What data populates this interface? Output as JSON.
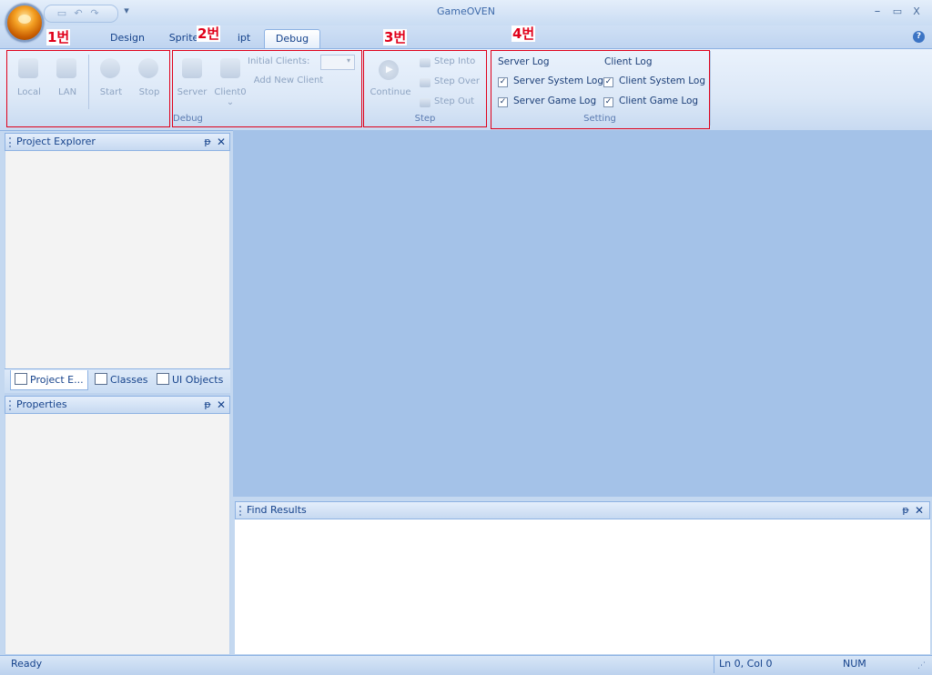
{
  "app": {
    "title": "GameOVEN"
  },
  "titlebar": {
    "minimize": "–",
    "maximize": "▭",
    "close": "X"
  },
  "qat": {
    "save_icon": "save-icon",
    "undo_icon": "undo-icon",
    "redo_icon": "redo-icon",
    "customize": "▾"
  },
  "tabs": [
    {
      "label": "Design"
    },
    {
      "label": "Sprite"
    },
    {
      "label": "ipt"
    },
    {
      "label": "Debug",
      "active": true
    }
  ],
  "help": "?",
  "ribbon": {
    "debug_group": {
      "label": "Debug",
      "buttons": {
        "local": "Local",
        "lan": "LAN",
        "start": "Start",
        "stop": "Stop",
        "server": "Server",
        "client0": "Client0"
      },
      "initial_clients_label": "Initial Clients:",
      "initial_clients_value": "",
      "add_client": "Add New Client"
    },
    "step_group": {
      "label": "Step",
      "continue": "Continue",
      "step_into": "Step Into",
      "step_over": "Step Over",
      "step_out": "Step Out"
    },
    "setting_group": {
      "label": "Setting",
      "server_log": "Server Log",
      "client_log": "Client Log",
      "server_system_log": "Server System Log",
      "client_system_log": "Client System Log",
      "server_game_log": "Server Game Log",
      "client_game_log": "Client Game Log",
      "check": "✓"
    }
  },
  "annotations": {
    "a1": "1번",
    "a2": "2번",
    "a3": "3번",
    "a4": "4번"
  },
  "panes": {
    "project_explorer": {
      "title": "Project Explorer"
    },
    "bottom_tabs": [
      {
        "label": "Project E..."
      },
      {
        "label": "Classes"
      },
      {
        "label": "UI Objects"
      }
    ],
    "properties": {
      "title": "Properties"
    },
    "find_results": {
      "title": "Find Results"
    },
    "pin": "ᵽ",
    "close": "✕"
  },
  "status": {
    "left": "Ready",
    "position": "Ln 0, Col 0",
    "num": "NUM"
  },
  "colors": {
    "accent": "#15428b",
    "workspace": "#a4c2e8",
    "annotation": "#e0001a"
  }
}
